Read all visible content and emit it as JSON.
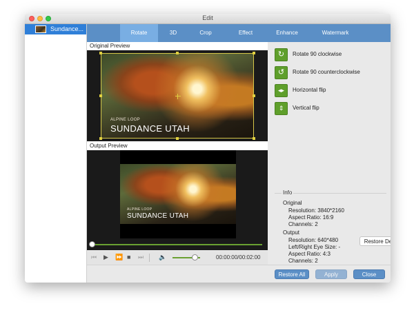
{
  "window": {
    "title": "Edit"
  },
  "sidebar": {
    "items": [
      {
        "label": "Sundance..."
      }
    ]
  },
  "tabs": [
    {
      "label": "Rotate",
      "active": true
    },
    {
      "label": "3D"
    },
    {
      "label": "Crop"
    },
    {
      "label": "Effect"
    },
    {
      "label": "Enhance"
    },
    {
      "label": "Watermark"
    }
  ],
  "preview": {
    "original_label": "Original Preview",
    "output_label": "Output Preview",
    "overlay_subtitle": "ALPINE LOOP",
    "overlay_title": "SUNDANCE UTAH"
  },
  "player": {
    "timecode": "00:00:00/00:02:00",
    "volume_level": 0.8,
    "progress": 0.0
  },
  "actions": [
    {
      "label": "Rotate 90 clockwise",
      "icon": "rotate-clockwise-icon"
    },
    {
      "label": "Rotate 90 counterclockwise",
      "icon": "rotate-counterclockwise-icon"
    },
    {
      "label": "Horizontal flip",
      "icon": "horizontal-flip-icon"
    },
    {
      "label": "Vertical flip",
      "icon": "vertical-flip-icon"
    }
  ],
  "info": {
    "legend": "Info",
    "original_heading": "Original",
    "original_resolution": "Resolution: 3840*2160",
    "original_aspect": "Aspect Ratio: 16:9",
    "original_channels": "Channels: 2",
    "output_heading": "Output",
    "output_resolution": "Resolution: 640*480",
    "output_eye_size": "Left/Right Eye Size: -",
    "output_aspect": "Aspect Ratio: 4:3",
    "output_channels": "Channels: 2"
  },
  "buttons": {
    "restore_defaults": "Restore Defaults",
    "restore_all": "Restore All",
    "apply": "Apply",
    "close": "Close"
  },
  "colors": {
    "accent_blue": "#5b8fc6",
    "active_tab": "#79aee3",
    "action_green": "#5f9f2b",
    "progress_green": "#6aa131",
    "sidebar_selected": "#2f7fd8"
  }
}
